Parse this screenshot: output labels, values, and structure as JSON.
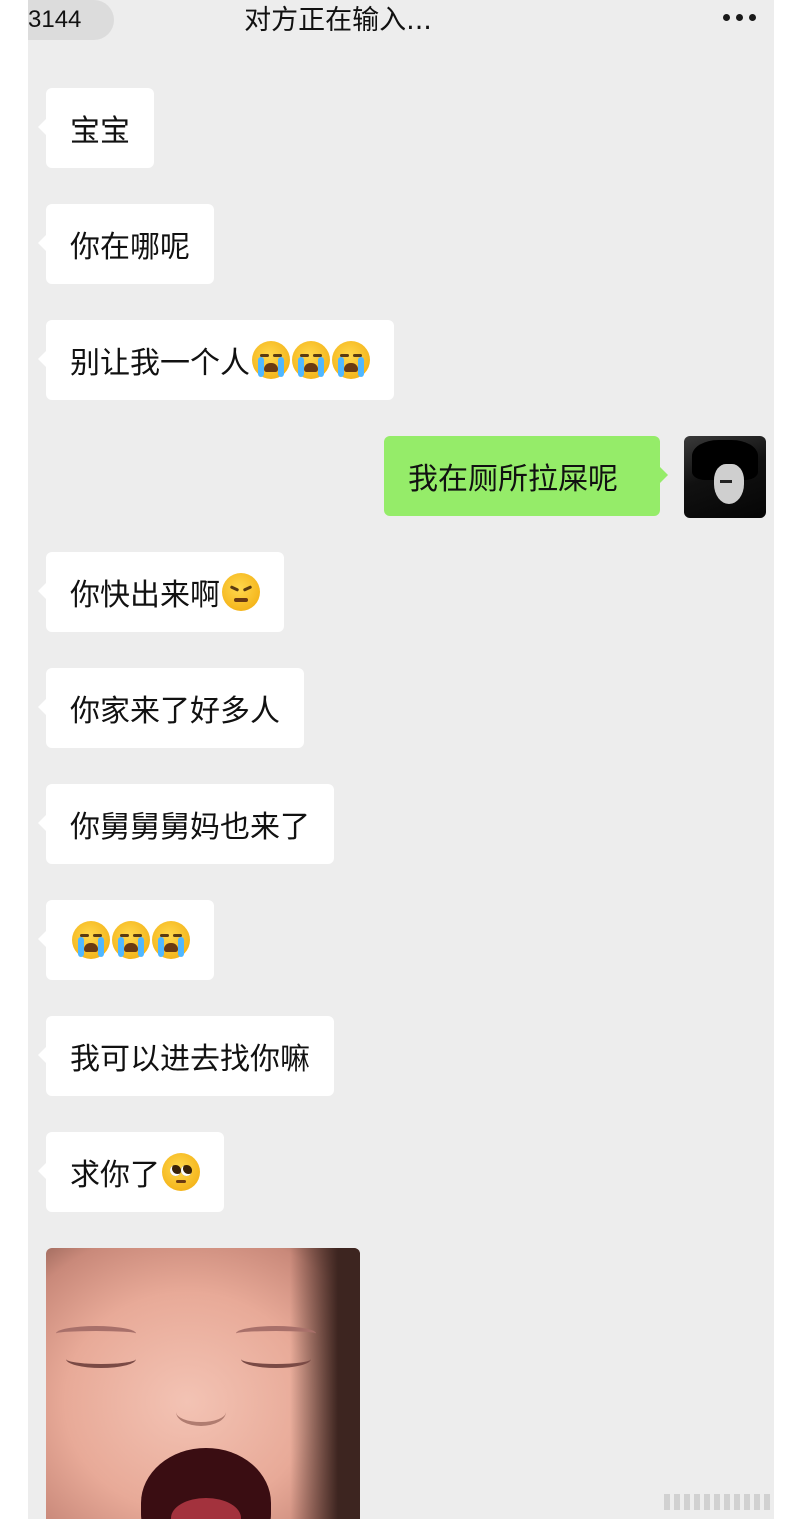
{
  "header": {
    "back_count": "3144",
    "title": "对方正在输入..."
  },
  "messages": [
    {
      "side": "in",
      "text": "宝宝",
      "emoji": []
    },
    {
      "side": "in",
      "text": "你在哪呢",
      "emoji": []
    },
    {
      "side": "in",
      "text": "别让我一个人",
      "emoji": [
        "loudly-crying-face",
        "loudly-crying-face",
        "loudly-crying-face"
      ]
    },
    {
      "side": "out",
      "text": "我在厕所拉屎呢",
      "emoji": []
    },
    {
      "side": "in",
      "text": "你快出来啊",
      "emoji": [
        "persevering-face"
      ]
    },
    {
      "side": "in",
      "text": "你家来了好多人",
      "emoji": []
    },
    {
      "side": "in",
      "text": "你舅舅舅妈也来了",
      "emoji": []
    },
    {
      "side": "in",
      "text": "",
      "emoji": [
        "loudly-crying-face",
        "loudly-crying-face",
        "loudly-crying-face"
      ]
    },
    {
      "side": "in",
      "text": "我可以进去找你嘛",
      "emoji": []
    },
    {
      "side": "in",
      "text": "求你了",
      "emoji": [
        "pleading-face"
      ]
    }
  ],
  "image_message": {
    "side": "in",
    "content": "crying-child-photo"
  },
  "colors": {
    "chat_background": "#ededed",
    "incoming_bubble": "#ffffff",
    "outgoing_bubble": "#95ec69"
  }
}
